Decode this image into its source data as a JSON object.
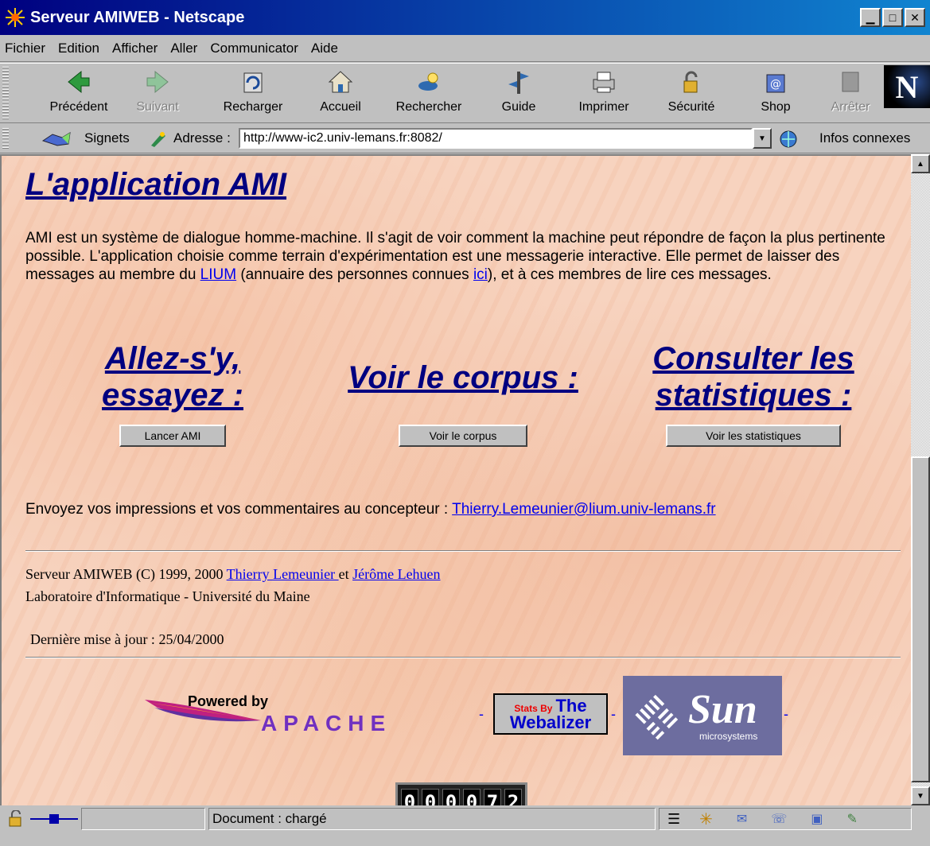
{
  "window": {
    "title": "Serveur AMIWEB - Netscape"
  },
  "menu": {
    "items": [
      "Fichier",
      "Edition",
      "Afficher",
      "Aller",
      "Communicator",
      "Aide"
    ]
  },
  "toolbar": {
    "buttons": [
      {
        "label": "Précédent",
        "icon": "back-arrow-icon"
      },
      {
        "label": "Suivant",
        "icon": "forward-arrow-icon"
      },
      {
        "label": "Recharger",
        "icon": "reload-icon"
      },
      {
        "label": "Accueil",
        "icon": "home-icon"
      },
      {
        "label": "Rechercher",
        "icon": "search-icon"
      },
      {
        "label": "Guide",
        "icon": "guide-icon"
      },
      {
        "label": "Imprimer",
        "icon": "print-icon"
      },
      {
        "label": "Sécurité",
        "icon": "lock-icon"
      },
      {
        "label": "Shop",
        "icon": "shop-icon"
      },
      {
        "label": "Arrêter",
        "icon": "stop-icon"
      }
    ]
  },
  "location": {
    "bookmarks_label": "Signets",
    "address_label": "Adresse :",
    "url": "http://www-ic2.univ-lemans.fr:8082/",
    "related_label": "Infos connexes"
  },
  "page": {
    "title": "L'application AMI",
    "intro_1": "AMI est un système de dialogue homme-machine. Il s'agit de voir comment la machine peut répondre de façon la plus pertinente possible. L'application choisie comme terrain d'expérimentation est une messagerie interactive. Elle permet de laisser des messages au membre du ",
    "intro_link_lium": "LIUM",
    "intro_2": " (annuaire des personnes connues ",
    "intro_link_ici": "ici",
    "intro_3": "), et à ces membres de lire ces messages.",
    "columns": [
      {
        "head_1": "Allez-s'y,",
        "head_2": "essayez :",
        "button": "Lancer AMI"
      },
      {
        "head_1": "Voir le corpus :",
        "head_2": "",
        "button": "Voir le corpus"
      },
      {
        "head_1": "Consulter les",
        "head_2": "statistiques :",
        "button": "Voir les statistiques"
      }
    ],
    "mail_text": "Envoyez vos impressions et vos commentaires au concepteur : ",
    "mail_link": "Thierry.Lemeunier@lium.univ-lemans.fr",
    "footer_1": "Serveur AMIWEB (C) 1999, 2000 ",
    "footer_link_1": "Thierry Lemeunier ",
    "footer_et": "et ",
    "footer_link_2": "Jérôme Lehuen",
    "footer_2": "Laboratoire d'Informatique - Université du Maine",
    "updated": "Dernière mise à jour : 25/04/2000",
    "apache_text_1": "Powered by",
    "apache_text_2": "APACHE",
    "webalizer_text_1": "Stats By",
    "webalizer_text_2": "The",
    "webalizer_text_3": "Webalizer",
    "sun_text": "Sun",
    "sun_sub": "microsystems",
    "sep": "-",
    "counter": [
      "0",
      "0",
      "0",
      "0",
      "7",
      "2"
    ]
  },
  "status": {
    "text": "Document : chargé"
  }
}
